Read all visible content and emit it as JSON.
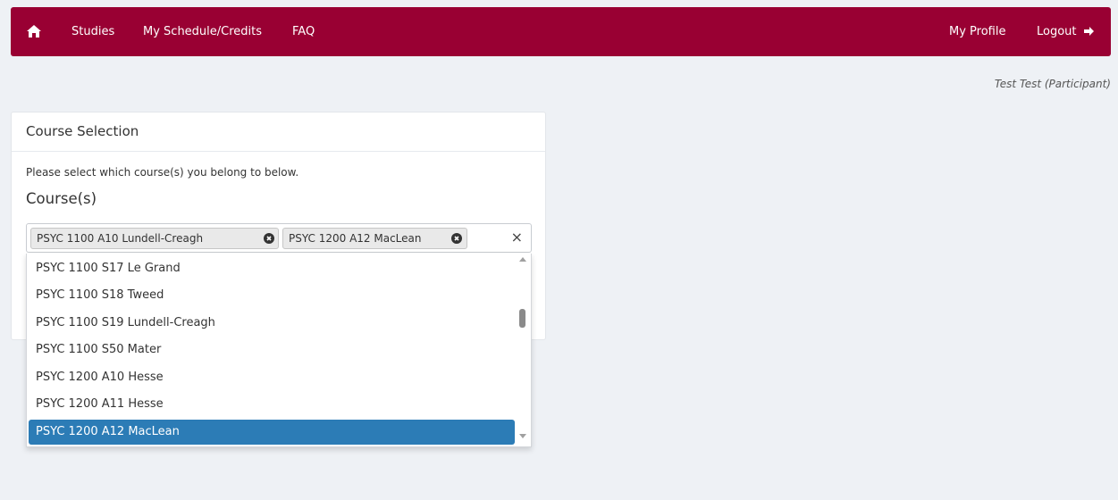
{
  "colors": {
    "navbar": "#990033",
    "selected_option": "#2c7cb6",
    "background": "#eef1f5"
  },
  "nav": {
    "home_icon": "home-icon",
    "items": [
      {
        "label": "Studies"
      },
      {
        "label": "My Schedule/Credits"
      },
      {
        "label": "FAQ"
      }
    ],
    "profile": "My Profile",
    "logout": "Logout",
    "logout_icon": "sign-out-icon"
  },
  "user": {
    "display": "Test Test (Participant)"
  },
  "panel": {
    "title": "Course Selection",
    "description": "Please select which course(s) you belong to below.",
    "field_label": "Course(s)"
  },
  "select": {
    "tags": [
      {
        "label": "PSYC 1100 A10 Lundell-Creagh"
      },
      {
        "label": "PSYC 1200 A12 MacLean"
      }
    ],
    "clear_symbol": "×",
    "options": [
      {
        "label": "PSYC 1100 S17 Le Grand"
      },
      {
        "label": "PSYC 1100 S18 Tweed"
      },
      {
        "label": "PSYC 1100 S19 Lundell-Creagh"
      },
      {
        "label": "PSYC 1100 S50 Mater"
      },
      {
        "label": "PSYC 1200 A10 Hesse"
      },
      {
        "label": "PSYC 1200 A11 Hesse"
      },
      {
        "label": "PSYC 1200 A12 MacLean"
      }
    ],
    "highlighted_option": "PSYC 1200 A12 MacLean"
  }
}
